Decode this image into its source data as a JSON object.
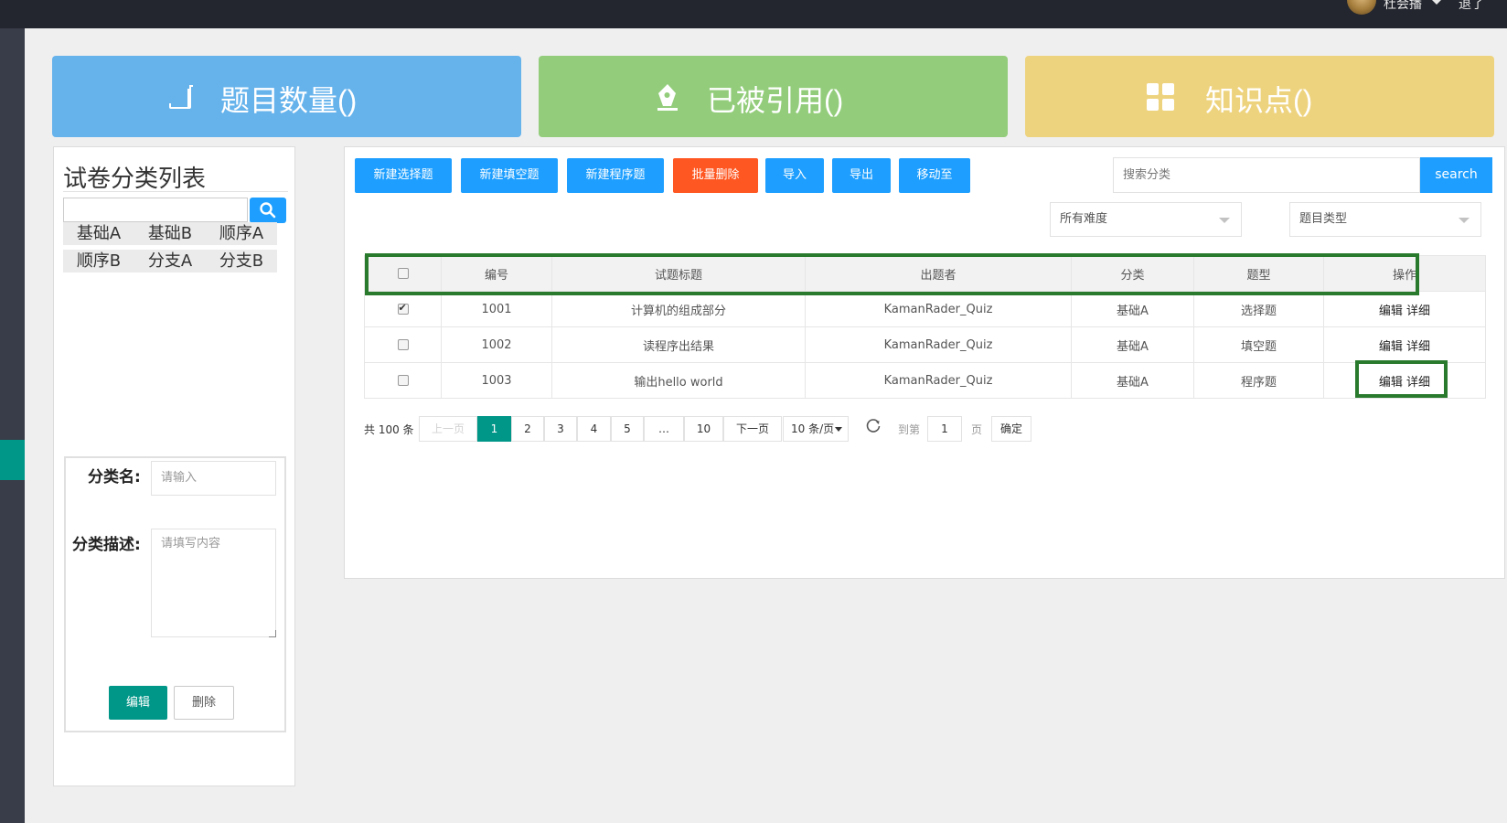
{
  "topbar": {
    "username": "杜会播",
    "logout": "退了"
  },
  "stats": [
    {
      "label": "题目数量()",
      "icon": "scroll-icon",
      "color": "#66b3ec"
    },
    {
      "label": "已被引用()",
      "icon": "pen-nib-icon",
      "color": "#93cd7b"
    },
    {
      "label": "知识点()",
      "icon": "grid-icon",
      "color": "#eed37f"
    }
  ],
  "sidebar": {
    "title": "试卷分类列表",
    "search_value": "",
    "categories": [
      "基础A",
      "基础B",
      "顺序A",
      "顺序B",
      "分支A",
      "分支B"
    ],
    "form": {
      "name_label": "分类名:",
      "name_placeholder": "请输入",
      "desc_label": "分类描述:",
      "desc_placeholder": "请填写内容",
      "edit_label": "编辑",
      "delete_label": "删除"
    }
  },
  "toolbar": {
    "buttons": [
      "新建选择题",
      "新建填空题",
      "新建程序题",
      "批量删除",
      "导入",
      "导出",
      "移动至"
    ],
    "search_placeholder": "搜索分类",
    "search_button": "search",
    "difficulty_select": "所有难度",
    "type_select": "题目类型"
  },
  "table": {
    "columns": [
      "编号",
      "试题标题",
      "出题者",
      "分类",
      "题型",
      "操作"
    ],
    "rows": [
      {
        "checked": true,
        "id": "1001",
        "title": "计算机的组成部分",
        "author": "KamanRader_Quiz",
        "category": "基础A",
        "type": "选择题",
        "ops": "编辑 详细"
      },
      {
        "checked": false,
        "id": "1002",
        "title": "读程序出结果",
        "author": "KamanRader_Quiz",
        "category": "基础A",
        "type": "填空题",
        "ops": "编辑 详细"
      },
      {
        "checked": false,
        "id": "1003",
        "title": "输出hello world",
        "author": "KamanRader_Quiz",
        "category": "基础A",
        "type": "程序题",
        "ops": "编辑 详细"
      }
    ]
  },
  "pagination": {
    "total": "共 100 条",
    "prev": "上一页",
    "pages": [
      "1",
      "2",
      "3",
      "4",
      "5",
      "…",
      "10"
    ],
    "current": "1",
    "next": "下一页",
    "limit": "10 条/页",
    "goto_prefix": "到第",
    "goto_value": "1",
    "goto_suffix": "页",
    "confirm": "确定"
  },
  "colors": {
    "primary": "#1e9fff",
    "danger": "#ff5722",
    "teal": "#009688",
    "highlight": "#2a7a2e"
  }
}
